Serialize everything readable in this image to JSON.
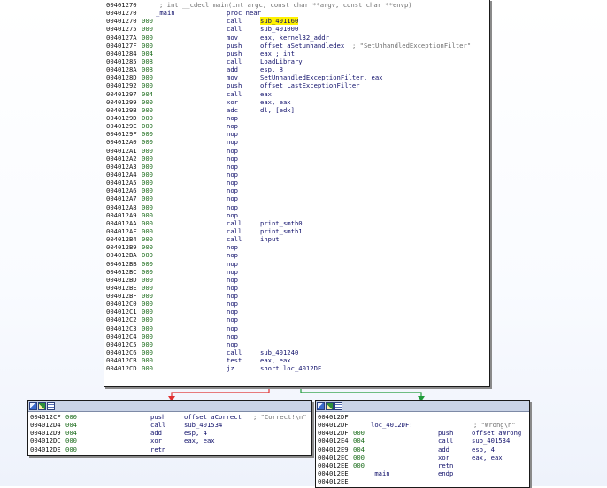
{
  "main_block": {
    "lines": [
      {
        "addr": "00401270",
        "sp": "",
        "mnem": "",
        "op": "",
        "comment": "; int __cdecl main(int argc, const char **argv, const char **envp)"
      },
      {
        "addr": "00401270",
        "sp": "",
        "mnem": "",
        "op": "",
        "label": "_main",
        "label2": "proc near"
      },
      {
        "addr": "00401270",
        "sp": "000",
        "mnem": "call",
        "op": "sub_401160",
        "hl": true
      },
      {
        "addr": "00401275",
        "sp": "000",
        "mnem": "call",
        "op": "sub_401000"
      },
      {
        "addr": "0040127A",
        "sp": "000",
        "mnem": "mov",
        "op": "eax, kernel32_addr"
      },
      {
        "addr": "0040127F",
        "sp": "000",
        "mnem": "push",
        "op": "offset aSetunhandledex",
        "comment": "; \"SetUnhandledExceptionFilter\""
      },
      {
        "addr": "00401284",
        "sp": "004",
        "mnem": "push",
        "op": "eax ; int"
      },
      {
        "addr": "00401285",
        "sp": "008",
        "mnem": "call",
        "op": "LoadLibrary"
      },
      {
        "addr": "0040128A",
        "sp": "008",
        "mnem": "add",
        "op": "esp, 8"
      },
      {
        "addr": "0040128D",
        "sp": "000",
        "mnem": "mov",
        "op": "SetUnhandledExceptionFilter, eax"
      },
      {
        "addr": "00401292",
        "sp": "000",
        "mnem": "push",
        "op": "offset LastExceptionFilter"
      },
      {
        "addr": "00401297",
        "sp": "004",
        "mnem": "call",
        "op": "eax"
      },
      {
        "addr": "00401299",
        "sp": "000",
        "mnem": "xor",
        "op": "eax, eax"
      },
      {
        "addr": "0040129B",
        "sp": "000",
        "mnem": "adc",
        "op": "dl, [edx]"
      },
      {
        "addr": "0040129D",
        "sp": "000",
        "mnem": "nop",
        "op": ""
      },
      {
        "addr": "0040129E",
        "sp": "000",
        "mnem": "nop",
        "op": ""
      },
      {
        "addr": "0040129F",
        "sp": "000",
        "mnem": "nop",
        "op": ""
      },
      {
        "addr": "004012A0",
        "sp": "000",
        "mnem": "nop",
        "op": ""
      },
      {
        "addr": "004012A1",
        "sp": "000",
        "mnem": "nop",
        "op": ""
      },
      {
        "addr": "004012A2",
        "sp": "000",
        "mnem": "nop",
        "op": ""
      },
      {
        "addr": "004012A3",
        "sp": "000",
        "mnem": "nop",
        "op": ""
      },
      {
        "addr": "004012A4",
        "sp": "000",
        "mnem": "nop",
        "op": ""
      },
      {
        "addr": "004012A5",
        "sp": "000",
        "mnem": "nop",
        "op": ""
      },
      {
        "addr": "004012A6",
        "sp": "000",
        "mnem": "nop",
        "op": ""
      },
      {
        "addr": "004012A7",
        "sp": "000",
        "mnem": "nop",
        "op": ""
      },
      {
        "addr": "004012A8",
        "sp": "000",
        "mnem": "nop",
        "op": ""
      },
      {
        "addr": "004012A9",
        "sp": "000",
        "mnem": "nop",
        "op": ""
      },
      {
        "addr": "004012AA",
        "sp": "000",
        "mnem": "call",
        "op": "print_smth0"
      },
      {
        "addr": "004012AF",
        "sp": "000",
        "mnem": "call",
        "op": "print_smth1"
      },
      {
        "addr": "004012B4",
        "sp": "000",
        "mnem": "call",
        "op": "input"
      },
      {
        "addr": "004012B9",
        "sp": "000",
        "mnem": "nop",
        "op": ""
      },
      {
        "addr": "004012BA",
        "sp": "000",
        "mnem": "nop",
        "op": ""
      },
      {
        "addr": "004012BB",
        "sp": "000",
        "mnem": "nop",
        "op": ""
      },
      {
        "addr": "004012BC",
        "sp": "000",
        "mnem": "nop",
        "op": ""
      },
      {
        "addr": "004012BD",
        "sp": "000",
        "mnem": "nop",
        "op": ""
      },
      {
        "addr": "004012BE",
        "sp": "000",
        "mnem": "nop",
        "op": ""
      },
      {
        "addr": "004012BF",
        "sp": "000",
        "mnem": "nop",
        "op": ""
      },
      {
        "addr": "004012C0",
        "sp": "000",
        "mnem": "nop",
        "op": ""
      },
      {
        "addr": "004012C1",
        "sp": "000",
        "mnem": "nop",
        "op": ""
      },
      {
        "addr": "004012C2",
        "sp": "000",
        "mnem": "nop",
        "op": ""
      },
      {
        "addr": "004012C3",
        "sp": "000",
        "mnem": "nop",
        "op": ""
      },
      {
        "addr": "004012C4",
        "sp": "000",
        "mnem": "nop",
        "op": ""
      },
      {
        "addr": "004012C5",
        "sp": "000",
        "mnem": "nop",
        "op": ""
      },
      {
        "addr": "004012C6",
        "sp": "000",
        "mnem": "call",
        "op": "sub_401240"
      },
      {
        "addr": "004012CB",
        "sp": "000",
        "mnem": "test",
        "op": "eax, eax"
      },
      {
        "addr": "004012CD",
        "sp": "000",
        "mnem": "jz",
        "op": "short loc_4012DF"
      }
    ]
  },
  "correct_block": {
    "lines": [
      {
        "addr": "004012CF",
        "sp": "000",
        "mnem": "push",
        "op": "offset aCorrect",
        "comment": "; \"Correct!\\n\""
      },
      {
        "addr": "004012D4",
        "sp": "004",
        "mnem": "call",
        "op": "sub_401534"
      },
      {
        "addr": "004012D9",
        "sp": "004",
        "mnem": "add",
        "op": "esp, 4"
      },
      {
        "addr": "004012DC",
        "sp": "000",
        "mnem": "xor",
        "op": "eax, eax"
      },
      {
        "addr": "004012DE",
        "sp": "000",
        "mnem": "retn",
        "op": ""
      }
    ]
  },
  "wrong_block": {
    "lines": [
      {
        "addr": "004012DF",
        "sp": "",
        "mnem": "",
        "op": ""
      },
      {
        "addr": "004012DF",
        "sp": "",
        "mnem": "",
        "op": "",
        "label": "loc_4012DF:",
        "comment": "; \"Wrong\\n\""
      },
      {
        "addr": "004012DF",
        "sp": "000",
        "mnem": "push",
        "op": "offset aWrong"
      },
      {
        "addr": "004012E4",
        "sp": "004",
        "mnem": "call",
        "op": "sub_401534"
      },
      {
        "addr": "004012E9",
        "sp": "004",
        "mnem": "add",
        "op": "esp, 4"
      },
      {
        "addr": "004012EC",
        "sp": "000",
        "mnem": "xor",
        "op": "eax, eax"
      },
      {
        "addr": "004012EE",
        "sp": "000",
        "mnem": "retn",
        "op": ""
      },
      {
        "addr": "004012EE",
        "sp": "",
        "mnem": "",
        "op": "",
        "label": "_main",
        "label2": "endp"
      },
      {
        "addr": "004012EE",
        "sp": "",
        "mnem": "",
        "op": ""
      }
    ]
  },
  "colors": {
    "true_branch_edge": "#e03030",
    "false_branch_edge": "#1f9b3a",
    "address_text": "#111111",
    "sp_delta_text": "#1a6b1a",
    "mnemonic_text": "#0f0f6a",
    "comment_text": "#6e6e6e",
    "highlight": "#fff200"
  },
  "icons": [
    "graph-view-icon",
    "image-icon",
    "text-view-icon"
  ]
}
